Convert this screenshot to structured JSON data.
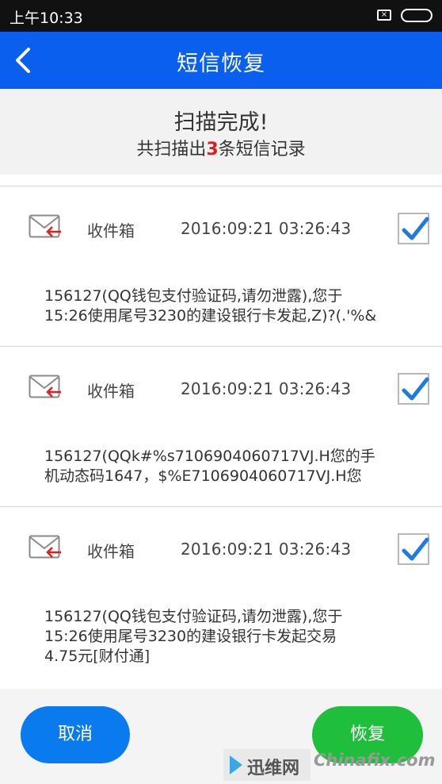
{
  "status_bar": {
    "time": "上午10:33"
  },
  "header": {
    "title": "短信恢复"
  },
  "summary": {
    "headline": "扫描完成!",
    "count_prefix": "共扫描出",
    "count": "3",
    "count_suffix": "条短信记录"
  },
  "messages": [
    {
      "folder": "收件箱",
      "datetime": "2016:09:21  03:26:43",
      "checked": true,
      "body": "156127(QQ钱包支付验证码,请勿泄露),您于\n15:26使用尾号3230的建设银行卡发起,Z)?(.'%&"
    },
    {
      "folder": "收件箱",
      "datetime": "2016:09:21  03:26:43",
      "checked": true,
      "body": "156127(QQk#%s7106904060717VJ.H您的手\n机动态码1647，$%E7106904060717VJ.H您"
    },
    {
      "folder": "收件箱",
      "datetime": "2016:09:21  03:26:43",
      "checked": true,
      "body": "156127(QQ钱包支付验证码,请勿泄露),您于\n15:26使用尾号3230的建设银行卡发起交易\n4.75元[财付通]"
    }
  ],
  "footer": {
    "cancel_label": "取消",
    "restore_label": "恢复"
  },
  "watermarks": {
    "left": "迅维网",
    "right": "Chinafix.com"
  },
  "colors": {
    "titlebar": "#0a5fef",
    "cancel_button": "#0a7bef",
    "restore_button": "#1fbf3b",
    "count_highlight": "#d91e1e",
    "checkmark": "#1e7be0"
  },
  "icons": {
    "back": "back-arrow-icon",
    "mail": "envelope-incoming-icon",
    "check": "checkmark-icon"
  }
}
